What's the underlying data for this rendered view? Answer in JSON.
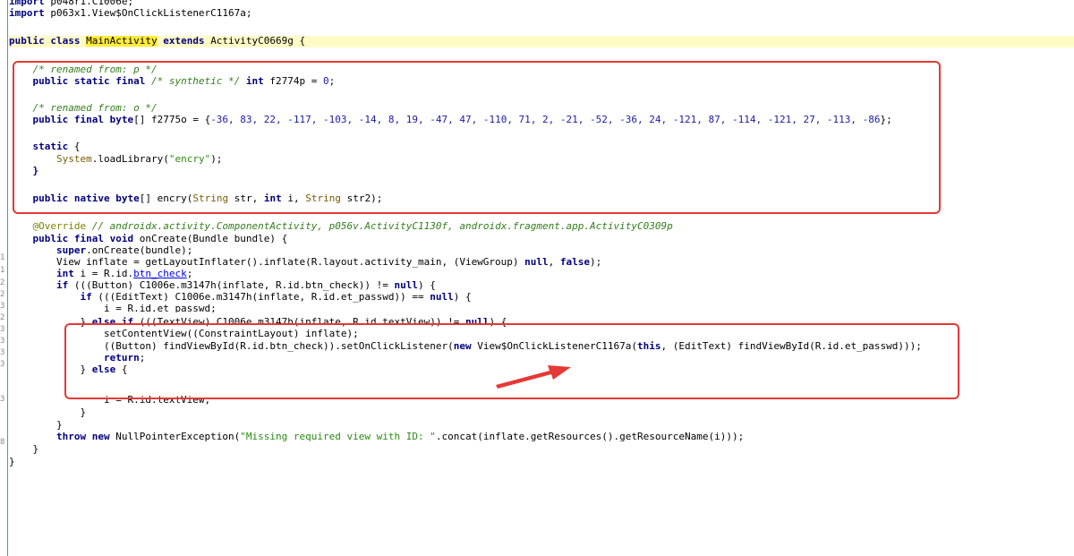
{
  "colors": {
    "keyword": "#000080",
    "string": "#2a8a13",
    "number": "#1a1aa6",
    "comment": "#347d1c",
    "annotation": "#808000",
    "class_highlight": "#ffeb3b",
    "line_highlight": "#fffbc7",
    "box": "#e53935",
    "gutter_border": "#4caf50"
  },
  "gutter": [
    "1",
    "1",
    "2",
    "2",
    "3",
    "2",
    "3",
    "3",
    "3",
    "3",
    "3",
    "8"
  ],
  "code": {
    "import1_kw": "import",
    "import1_name": " p048r1.C1006e;",
    "import2_kw": "import",
    "import2_name": " p063x1.View$OnClickListenerC1167a;",
    "decl_kw1": "public class ",
    "decl_name": "MainActivity",
    "decl_kw2": " extends ",
    "decl_parent": "ActivityC0669g",
    "decl_brace": " {",
    "cmt_p": "/* renamed from: p */",
    "p_kw": "public static final ",
    "p_cmt": "/* synthetic */",
    "p_int": " int",
    "p_rest": " f2774p = ",
    "p_val": "0",
    "p_end": ";",
    "cmt_o": "/* renamed from: o */",
    "o_kw": "public final byte",
    "o_mid": "[] f2775o = {",
    "o_values": "-36, 83, 22, -117, -103, -14, 8, 19, -47, 47, -110, 71, 2, -21, -52, -36, 24, -121, 87, -114, -121, 27, -113, -86",
    "o_end": "};",
    "static_kw": "static",
    "static_brace": " {",
    "load_cls": "System",
    "load_rest": ".loadLibrary(",
    "load_str": "\"encry\"",
    "load_end": ");",
    "close_brace": "}",
    "native_kw": "public native byte",
    "native_mid": "[] encry(",
    "native_t1": "String",
    "native_a1": " str, ",
    "native_int": "int",
    "native_a2": " i, ",
    "native_t2": "String",
    "native_end": " str2);",
    "override_ann": "@Override",
    "override_cmt": " // androidx.activity.ComponentActivity, p056v.ActivityC1130f, androidx.fragment.app.ActivityC0309p",
    "oncreate_kw": "public final void",
    "oncreate_rest": " onCreate(Bundle bundle) {",
    "super_kw": "super",
    "super_rest": ".onCreate(bundle);",
    "inflate_a": "View inflate = getLayoutInflater().inflate(R.layout.activity_main, (ViewGroup) ",
    "inflate_null": "null",
    "inflate_b": ", ",
    "inflate_false": "false",
    "inflate_end": ");",
    "int_kw": "int",
    "int_a": " i = R.id.",
    "int_link": "btn_check",
    "int_end": ";",
    "if1_kw": "if",
    "if1_a": " (((Button) C1006e.m3147h(inflate, R.id.btn_check)) != ",
    "if1_null": "null",
    "if1_end": ") {",
    "if2_kw": "if",
    "if2_a": " (((EditText) C1006e.m3147h(inflate, R.id.et_passwd)) == ",
    "if2_null": "null",
    "if2_end": ") {",
    "i_passwd": "i = R.id.et_passwd;",
    "elseif_a": "} ",
    "elseif_kw1": "else if",
    "elseif_b": " (((TextView) C1006e.m3147h(inflate, R.id.textView)) != ",
    "elseif_null": "null",
    "elseif_end": ") {",
    "setcv": "setContentView((ConstraintLayout) inflate);",
    "find_a": "((Button) findViewById(R.id.btn_check)).setOnClickListener(",
    "find_new": "new",
    "find_b": " View$OnClickListenerC1167a(",
    "find_this": "this",
    "find_c": ", (EditText) findViewById(R.id.et_passwd)));",
    "return_kw": "return",
    "return_end": ";",
    "else_a": "} ",
    "else_kw": "else",
    "else_end": " {",
    "i_textview": "i = R.id.textView;",
    "throw_kw": "throw new",
    "throw_a": " NullPointerException(",
    "throw_str": "\"Missing required view with ID: \"",
    "throw_end": ".concat(inflate.getResources().getResourceName(i)));"
  }
}
